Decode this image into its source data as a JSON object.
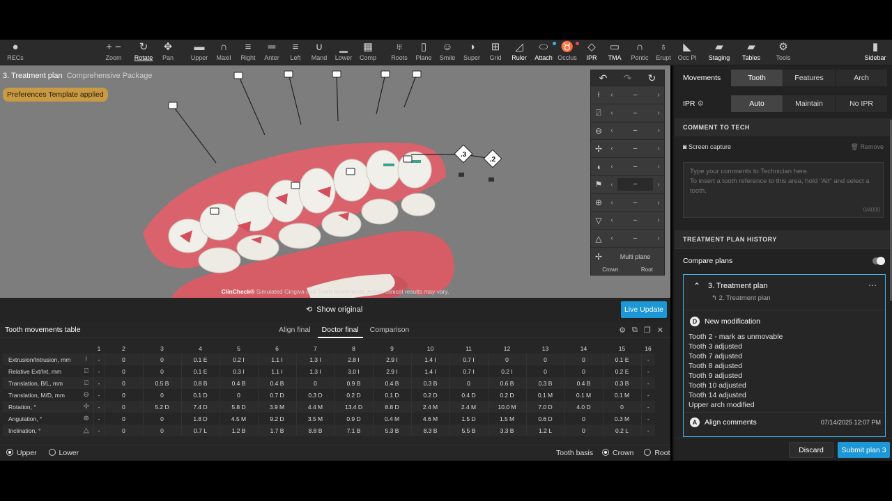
{
  "toolbar": {
    "items": [
      {
        "label": "RECs",
        "icon": "person-icon"
      },
      {
        "label": "Zoom",
        "icon": "zoom-icon"
      },
      {
        "label": "Rotate",
        "icon": "rotate-icon"
      },
      {
        "label": "Pan",
        "icon": "pan-icon"
      },
      {
        "label": "Upper",
        "icon": "upper-icon"
      },
      {
        "label": "Maxil",
        "icon": "maxil-icon"
      },
      {
        "label": "Right",
        "icon": "right-view-icon"
      },
      {
        "label": "Anter",
        "icon": "anterior-view-icon"
      },
      {
        "label": "Left",
        "icon": "left-view-icon"
      },
      {
        "label": "Mand",
        "icon": "mandible-icon"
      },
      {
        "label": "Lower",
        "icon": "lower-icon"
      },
      {
        "label": "Comp",
        "icon": "compare-icon"
      },
      {
        "label": "Roots",
        "icon": "roots-icon"
      },
      {
        "label": "Plane",
        "icon": "plane-icon"
      },
      {
        "label": "Smile",
        "icon": "smile-icon"
      },
      {
        "label": "Super",
        "icon": "superimpose-icon"
      },
      {
        "label": "Grid",
        "icon": "grid-icon"
      },
      {
        "label": "Ruler",
        "icon": "ruler-icon"
      },
      {
        "label": "Attach",
        "icon": "attach-icon"
      },
      {
        "label": "Occlus",
        "icon": "occlusion-icon"
      },
      {
        "label": "IPR",
        "icon": "ipr-icon"
      },
      {
        "label": "TMA",
        "icon": "tma-icon"
      },
      {
        "label": "Pontic",
        "icon": "pontic-icon"
      },
      {
        "label": "Erupt",
        "icon": "erupt-icon"
      },
      {
        "label": "Occ Pl",
        "icon": "occlusal-plane-icon"
      },
      {
        "label": "Staging",
        "icon": "staging-icon"
      },
      {
        "label": "Tables",
        "icon": "tables-icon"
      },
      {
        "label": "Tools",
        "icon": "gear-icon"
      },
      {
        "label": "Sidebar",
        "icon": "sidebar-icon"
      }
    ]
  },
  "viewport": {
    "title": "3. Treatment plan",
    "subtitle": "Comprehensive Package",
    "preference_badge": "Preferences Template applied",
    "tooth_tag_left": ".3",
    "tooth_tag_right": ".2",
    "disclaimer_brand": "ClinCheck®",
    "disclaimer_text": "Simulated Gingiva and Tooth movements. Actual clinical results may vary.",
    "panel_value": "–",
    "panel_multi": "Multi plane",
    "panel_crown": "Crown",
    "panel_root": "Root"
  },
  "actionbar": {
    "show_original": "Show original",
    "live_update": "Live Update"
  },
  "movements_table": {
    "title": "Tooth movements table",
    "tabs": [
      "Align final",
      "Doctor final",
      "Comparison"
    ],
    "active_tab": "Doctor final",
    "columns": [
      "1",
      "2",
      "3",
      "4",
      "5",
      "6",
      "7",
      "8",
      "9",
      "10",
      "11",
      "12",
      "13",
      "14",
      "15",
      "16"
    ],
    "rows": [
      {
        "label": "Extrusion/Intrusion, mm",
        "values": [
          "-",
          "0",
          "0",
          "0.1 E",
          "0.2 I",
          "1.1 I",
          "1.3 I",
          "2.8 I",
          "2.9 I",
          "1.4 I",
          "0.7 I",
          "0",
          "0",
          "0",
          "0.1 E",
          "-"
        ]
      },
      {
        "label": "Relative Ext/Int, mm",
        "values": [
          "-",
          "0",
          "0",
          "0.1 E",
          "0.3 I",
          "1.1 I",
          "1.3 I",
          "3.0 I",
          "2.9 I",
          "1.4 I",
          "0.7 I",
          "0.2 I",
          "0",
          "0",
          "0.2 E",
          "-"
        ]
      },
      {
        "label": "Translation, B/L, mm",
        "values": [
          "-",
          "0",
          "0.5 B",
          "0.8 B",
          "0.4 B",
          "0.4 B",
          "0",
          "0.9 B",
          "0.4 B",
          "0.3 B",
          "0",
          "0.6 B",
          "0.3 B",
          "0.4 B",
          "0.3 B",
          "-"
        ]
      },
      {
        "label": "Translation, M/D, mm",
        "values": [
          "-",
          "0",
          "0",
          "0.1 D",
          "0",
          "0.7 D",
          "0.3 D",
          "0.2 D",
          "0.1 D",
          "0.2 D",
          "0.4 D",
          "0.2 D",
          "0.1 M",
          "0.1 M",
          "0.1 M",
          "-"
        ]
      },
      {
        "label": "Rotation, °",
        "values": [
          "-",
          "0",
          "5.2 D",
          "7.4 D",
          "5.8 D",
          "3.9 M",
          "4.4 M",
          "13.4 D",
          "8.8 D",
          "2.4 M",
          "2.4 M",
          "10.0 M",
          "7.0 D",
          "4.0 D",
          "0",
          "-"
        ]
      },
      {
        "label": "Angulation, °",
        "values": [
          "-",
          "0",
          "0",
          "1.8 D",
          "4.5 M",
          "9.2 D",
          "3.5 M",
          "0.9 D",
          "0.4 M",
          "4.6 M",
          "1.5 D",
          "1.5 M",
          "0.6 D",
          "0",
          "0.3 M",
          "-"
        ]
      },
      {
        "label": "Inclination, °",
        "values": [
          "-",
          "0",
          "0",
          "0.7 L",
          "1.2 B",
          "1.7 B",
          "8.8 B",
          "7.1 B",
          "5.3 B",
          "8.3 B",
          "5.5 B",
          "3.3 B",
          "1.2 L",
          "0",
          "0.2 L",
          "-"
        ]
      }
    ],
    "arch_upper": "Upper",
    "arch_lower": "Lower",
    "tooth_basis": "Tooth basis",
    "basis_crown": "Crown",
    "basis_root": "Root"
  },
  "sidebar": {
    "movements_label": "Movements",
    "movements_options": [
      "Tooth",
      "Features",
      "Arch"
    ],
    "ipr_label": "IPR",
    "ipr_options": [
      "Auto",
      "Maintain",
      "No IPR"
    ],
    "comment_head": "COMMENT TO TECH",
    "screen_capture": "Screen capture",
    "remove": "Remove",
    "comment_placeholder": "Type your comments to Technician here.\nTo insert a tooth reference to this area, hold \"Alt\" and select a tooth.",
    "comment_count": "0/4000",
    "history_head": "TREATMENT PLAN HISTORY",
    "compare_plans": "Compare plans",
    "plan": {
      "title": "3. Treatment plan",
      "parent": "2. Treatment plan",
      "mod_badge": "D",
      "mod_title": "New modification",
      "changes": [
        "Tooth 2 - mark as unmovable",
        "Tooth 3 adjusted",
        "Tooth 7 adjusted",
        "Tooth 8 adjusted",
        "Tooth 9 adjusted",
        "Tooth 10 adjusted",
        "Tooth 14 adjusted",
        "Upper arch modified"
      ],
      "align_badge": "A",
      "align_title": "Align comments",
      "align_date": "07/14/2025 12:07 PM"
    },
    "discard": "Discard",
    "submit": "Submit plan 3"
  }
}
